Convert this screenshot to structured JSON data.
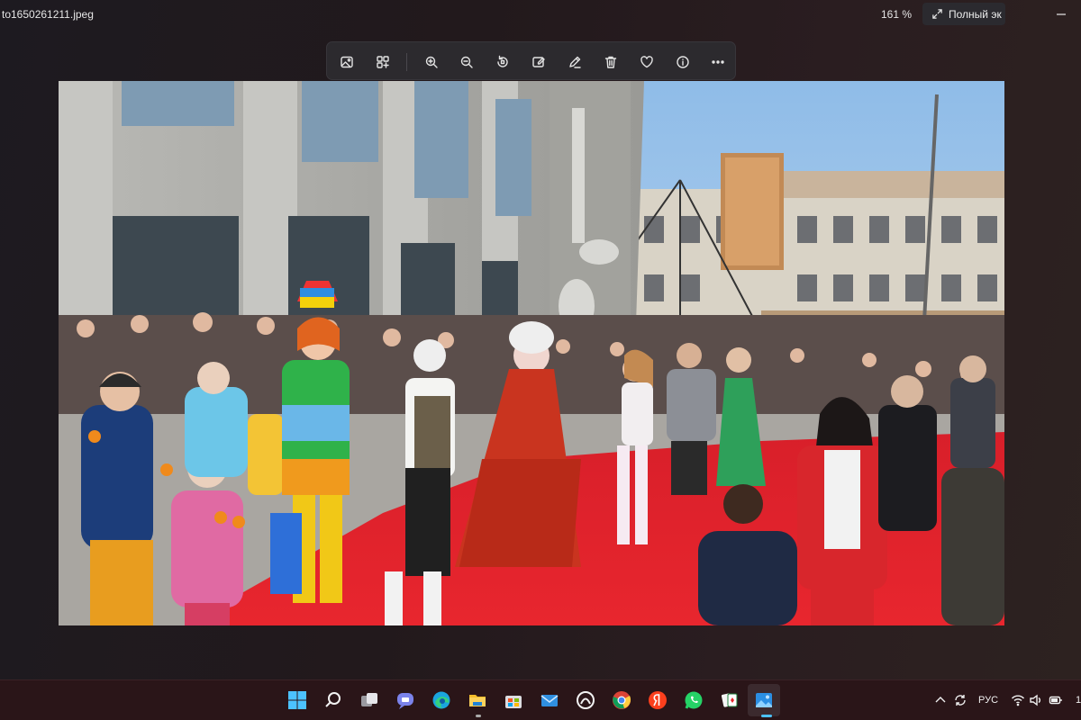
{
  "window": {
    "filename": "to1650261211.jpeg",
    "zoom": "161 %",
    "fullscreen_label": "Полный эк"
  },
  "toolbar": {
    "buttons": [
      {
        "name": "image-icon",
        "tooltip": "Image"
      },
      {
        "name": "gallery-icon",
        "tooltip": "Gallery"
      },
      {
        "name": "zoom-in-icon",
        "tooltip": "Zoom in"
      },
      {
        "name": "zoom-out-icon",
        "tooltip": "Zoom out"
      },
      {
        "name": "rotate-icon",
        "tooltip": "Rotate"
      },
      {
        "name": "edit-image-icon",
        "tooltip": "Edit image"
      },
      {
        "name": "draw-icon",
        "tooltip": "Draw"
      },
      {
        "name": "delete-icon",
        "tooltip": "Delete"
      },
      {
        "name": "favorite-icon",
        "tooltip": "Favorite"
      },
      {
        "name": "info-icon",
        "tooltip": "Info"
      },
      {
        "name": "more-icon",
        "tooltip": "More"
      }
    ]
  },
  "taskbar": {
    "apps": [
      "start",
      "search",
      "task-view",
      "teams-chat",
      "edge",
      "file-explorer",
      "store",
      "mail",
      "app",
      "chrome",
      "yandex",
      "whatsapp",
      "solitaire",
      "photos"
    ],
    "language": "РУС",
    "clock_fragment": "1"
  },
  "colors": {
    "accent": "#4cc2ff",
    "carpet": "#e3222b",
    "sky": "#a9cdef"
  }
}
